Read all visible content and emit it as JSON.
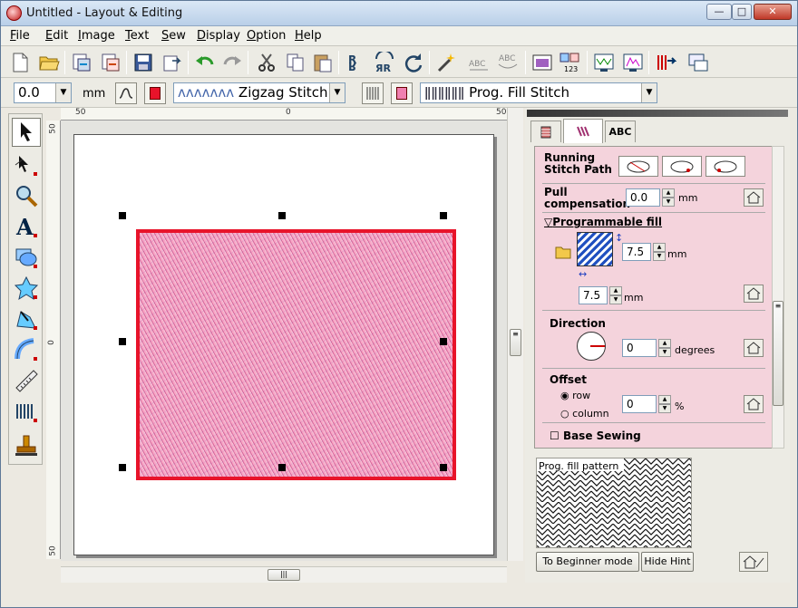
{
  "window": {
    "title": "Untitled - Layout & Editing",
    "controls": [
      "minimize",
      "maximize",
      "close"
    ]
  },
  "menu": [
    {
      "label": "File",
      "key": "F",
      "rest": "ile"
    },
    {
      "label": "Edit",
      "key": "E",
      "rest": "dit"
    },
    {
      "label": "Image",
      "key": "I",
      "rest": "mage"
    },
    {
      "label": "Text",
      "key": "T",
      "rest": "ext"
    },
    {
      "label": "Sew",
      "key": "S",
      "rest": "ew"
    },
    {
      "label": "Display",
      "key": "D",
      "rest": "isplay"
    },
    {
      "label": "Option",
      "key": "O",
      "rest": "ption"
    },
    {
      "label": "Help",
      "key": "H",
      "rest": "elp"
    }
  ],
  "attrbar": {
    "width_value": "0.0",
    "width_unit": "mm",
    "line_stitch": "Zigzag Stitch",
    "fill_stitch": "Prog. Fill Stitch"
  },
  "ruler": {
    "top_labels": [
      "50",
      "0",
      "50"
    ],
    "left_labels": [
      "50",
      "0",
      "50"
    ]
  },
  "panel": {
    "tabs": [
      "thread-tab",
      "fill-tab",
      "ABC"
    ],
    "running_stitch_path": "Running Stitch Path",
    "pull_compensation_label": "Pull compensation",
    "pull_compensation_value": "0.0",
    "mm": "mm",
    "programmable_fill": "Programmable fill",
    "pattern_height": "7.5",
    "pattern_width": "7.5",
    "direction_label": "Direction",
    "direction_value": "0",
    "degrees": "degrees",
    "offset_label": "Offset",
    "offset_row": "row",
    "offset_column": "column",
    "offset_value": "0",
    "percent": "%",
    "base_sewing": "Base Sewing",
    "preview_label": "Prog. fill pattern",
    "beginner_button": "To Beginner mode",
    "hint_button": "Hide Hint"
  },
  "colors": {
    "outline": "#e8132a",
    "fill": "#f0a4c4",
    "panel": "#f4d3dc"
  }
}
